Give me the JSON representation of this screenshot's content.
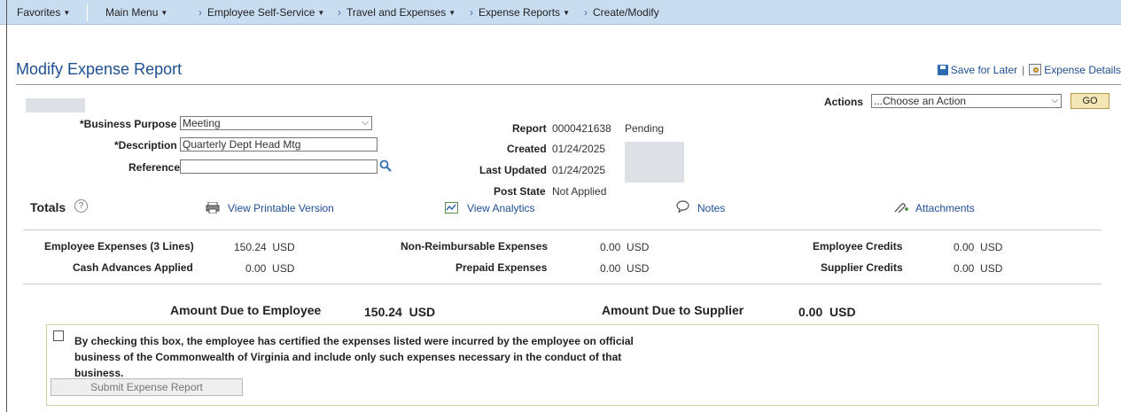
{
  "nav": {
    "favorites": "Favorites",
    "main_menu": "Main Menu",
    "crumbs": [
      "Employee Self-Service",
      "Travel and Expenses",
      "Expense Reports",
      "Create/Modify"
    ]
  },
  "page": {
    "title": "Modify Expense Report",
    "save_for_later": "Save for Later",
    "separator": "|",
    "expense_details": "Expense Details"
  },
  "actions": {
    "label": "Actions",
    "selected": "...Choose an Action",
    "go": "GO"
  },
  "form": {
    "business_purpose_label": "*Business Purpose",
    "business_purpose_value": "Meeting",
    "description_label": "*Description",
    "description_value": "Quarterly Dept Head Mtg",
    "reference_label": "Reference",
    "reference_value": ""
  },
  "report": {
    "report_label": "Report",
    "report_id": "0000421638",
    "status": "Pending",
    "created_label": "Created",
    "created": "01/24/2025",
    "last_updated_label": "Last Updated",
    "last_updated": "01/24/2025",
    "post_state_label": "Post State",
    "post_state": "Not Applied"
  },
  "links": {
    "totals": "Totals",
    "printable": "View Printable Version",
    "analytics": "View Analytics",
    "notes": "Notes",
    "attachments": "Attachments"
  },
  "totals": {
    "employee_expenses_label": "Employee Expenses (3 Lines)",
    "employee_expenses": "150.24",
    "cash_advances_label": "Cash Advances Applied",
    "cash_advances": "0.00",
    "non_reimbursable_label": "Non-Reimbursable Expenses",
    "non_reimbursable": "0.00",
    "prepaid_label": "Prepaid Expenses",
    "prepaid": "0.00",
    "employee_credits_label": "Employee Credits",
    "employee_credits": "0.00",
    "supplier_credits_label": "Supplier Credits",
    "supplier_credits": "0.00",
    "currency": "USD"
  },
  "due": {
    "employee_label": "Amount Due to Employee",
    "employee_value": "150.24  USD",
    "supplier_label": "Amount Due to Supplier",
    "supplier_value": "0.00  USD"
  },
  "certification": {
    "text": "By checking this box, the employee has certified the expenses listed were incurred by the employee on official business of the Commonwealth of Virginia and include only such expenses necessary in the conduct of that business.",
    "submit": "Submit Expense Report"
  },
  "colors": {
    "nav_bg": "#c9ddf1",
    "link": "#1e4f91",
    "go_bg": "#f5e6b5"
  }
}
